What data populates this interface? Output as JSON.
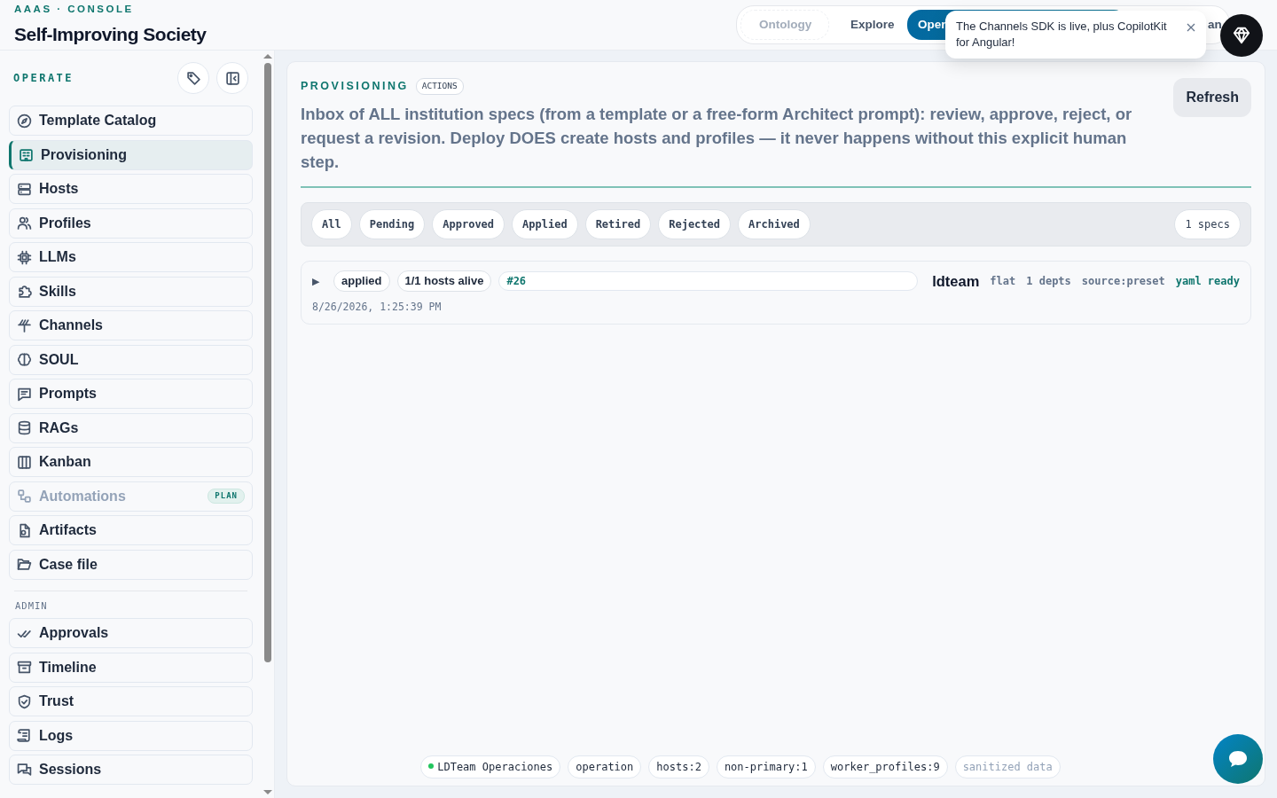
{
  "brand": {
    "eyebrow": "AAAS · CONSOLE",
    "title": "Self-Improving Society"
  },
  "top_tabs": [
    {
      "label": "Ontology",
      "selected": false,
      "disabled": true
    },
    {
      "label": "Explore",
      "selected": false,
      "disabled": false
    },
    {
      "label": "Oper",
      "selected": true,
      "disabled": false
    },
    {
      "label": "an",
      "selected": false,
      "disabled": false
    }
  ],
  "toast": {
    "message": "The Channels SDK is live, plus CopilotKit for Angular!"
  },
  "sidebar": {
    "section_title": "OPERATE",
    "items": [
      {
        "label": "Template Catalog",
        "selected": false,
        "disabled": false
      },
      {
        "label": "Provisioning",
        "selected": true,
        "disabled": false
      },
      {
        "label": "Hosts",
        "selected": false,
        "disabled": false
      },
      {
        "label": "Profiles",
        "selected": false,
        "disabled": false
      },
      {
        "label": "LLMs",
        "selected": false,
        "disabled": false
      },
      {
        "label": "Skills",
        "selected": false,
        "disabled": false
      },
      {
        "label": "Channels",
        "selected": false,
        "disabled": false
      },
      {
        "label": "SOUL",
        "selected": false,
        "disabled": false
      },
      {
        "label": "Prompts",
        "selected": false,
        "disabled": false
      },
      {
        "label": "RAGs",
        "selected": false,
        "disabled": false
      },
      {
        "label": "Kanban",
        "selected": false,
        "disabled": false
      },
      {
        "label": "Automations",
        "selected": false,
        "disabled": true,
        "badge": "PLAN"
      },
      {
        "label": "Artifacts",
        "selected": false,
        "disabled": false
      },
      {
        "label": "Case file",
        "selected": false,
        "disabled": false
      }
    ],
    "admin_title": "ADMIN",
    "admin_items": [
      {
        "label": "Approvals",
        "selected": false,
        "disabled": false
      },
      {
        "label": "Timeline",
        "selected": false,
        "disabled": false
      },
      {
        "label": "Trust",
        "selected": false,
        "disabled": false
      },
      {
        "label": "Logs",
        "selected": false,
        "disabled": false
      },
      {
        "label": "Sessions",
        "selected": false,
        "disabled": false
      }
    ]
  },
  "panel": {
    "title": "PROVISIONING",
    "tag": "ACTIONS",
    "refresh": "Refresh",
    "description": "Inbox of ALL institution specs (from a template or a free-form Architect prompt): review, approve, reject, or request a revision. Deploy DOES create hosts and profiles — it never happens without this explicit human step.",
    "filters": [
      {
        "label": "All",
        "selected": false
      },
      {
        "label": "Pending",
        "selected": false
      },
      {
        "label": "Approved",
        "selected": false
      },
      {
        "label": "Applied",
        "selected": false
      },
      {
        "label": "Retired",
        "selected": false
      },
      {
        "label": "Rejected",
        "selected": false
      },
      {
        "label": "Archived",
        "selected": false
      }
    ],
    "count": "1 specs",
    "specs": [
      {
        "expanded": false,
        "caret": "▶",
        "status": "applied",
        "hosts": "1/1 hosts alive",
        "number": "#26",
        "name": "ldteam",
        "layout": "flat",
        "depts": "1 depts",
        "source": "source:preset",
        "yaml": "yaml ready",
        "timestamp": "8/26/2026, 1:25:39 PM"
      }
    ]
  },
  "footer_chips": [
    {
      "label": "LDTeam Operaciones",
      "kind": "status",
      "color": "#22c55e"
    },
    {
      "label": "operation",
      "kind": "plain"
    },
    {
      "label": "hosts:2",
      "kind": "plain"
    },
    {
      "label": "non-primary:1",
      "kind": "plain"
    },
    {
      "label": "worker_profiles:9",
      "kind": "plain"
    },
    {
      "label": "sanitized data",
      "kind": "muted"
    }
  ]
}
